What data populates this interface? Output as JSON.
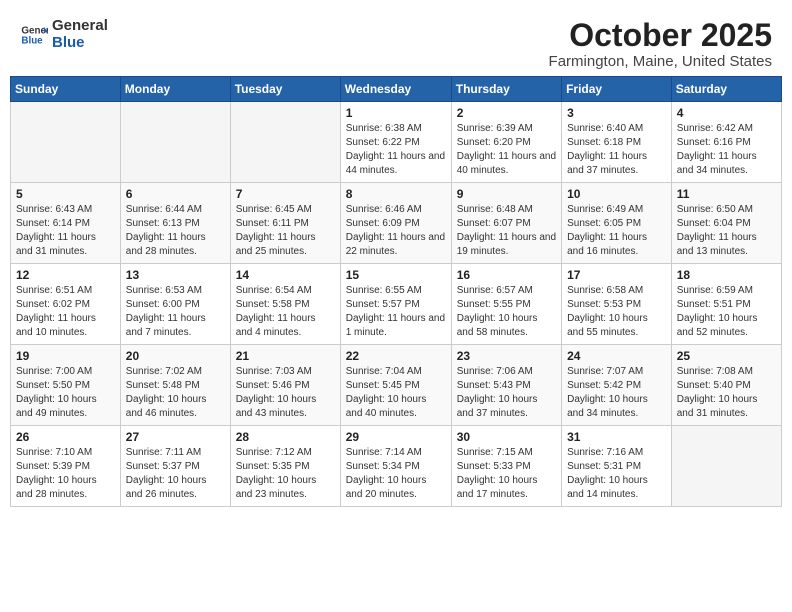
{
  "header": {
    "logo_general": "General",
    "logo_blue": "Blue",
    "month": "October 2025",
    "location": "Farmington, Maine, United States"
  },
  "weekdays": [
    "Sunday",
    "Monday",
    "Tuesday",
    "Wednesday",
    "Thursday",
    "Friday",
    "Saturday"
  ],
  "weeks": [
    [
      {
        "day": "",
        "info": ""
      },
      {
        "day": "",
        "info": ""
      },
      {
        "day": "",
        "info": ""
      },
      {
        "day": "1",
        "info": "Sunrise: 6:38 AM\nSunset: 6:22 PM\nDaylight: 11 hours\nand 44 minutes."
      },
      {
        "day": "2",
        "info": "Sunrise: 6:39 AM\nSunset: 6:20 PM\nDaylight: 11 hours\nand 40 minutes."
      },
      {
        "day": "3",
        "info": "Sunrise: 6:40 AM\nSunset: 6:18 PM\nDaylight: 11 hours\nand 37 minutes."
      },
      {
        "day": "4",
        "info": "Sunrise: 6:42 AM\nSunset: 6:16 PM\nDaylight: 11 hours\nand 34 minutes."
      }
    ],
    [
      {
        "day": "5",
        "info": "Sunrise: 6:43 AM\nSunset: 6:14 PM\nDaylight: 11 hours\nand 31 minutes."
      },
      {
        "day": "6",
        "info": "Sunrise: 6:44 AM\nSunset: 6:13 PM\nDaylight: 11 hours\nand 28 minutes."
      },
      {
        "day": "7",
        "info": "Sunrise: 6:45 AM\nSunset: 6:11 PM\nDaylight: 11 hours\nand 25 minutes."
      },
      {
        "day": "8",
        "info": "Sunrise: 6:46 AM\nSunset: 6:09 PM\nDaylight: 11 hours\nand 22 minutes."
      },
      {
        "day": "9",
        "info": "Sunrise: 6:48 AM\nSunset: 6:07 PM\nDaylight: 11 hours\nand 19 minutes."
      },
      {
        "day": "10",
        "info": "Sunrise: 6:49 AM\nSunset: 6:05 PM\nDaylight: 11 hours\nand 16 minutes."
      },
      {
        "day": "11",
        "info": "Sunrise: 6:50 AM\nSunset: 6:04 PM\nDaylight: 11 hours\nand 13 minutes."
      }
    ],
    [
      {
        "day": "12",
        "info": "Sunrise: 6:51 AM\nSunset: 6:02 PM\nDaylight: 11 hours\nand 10 minutes."
      },
      {
        "day": "13",
        "info": "Sunrise: 6:53 AM\nSunset: 6:00 PM\nDaylight: 11 hours\nand 7 minutes."
      },
      {
        "day": "14",
        "info": "Sunrise: 6:54 AM\nSunset: 5:58 PM\nDaylight: 11 hours\nand 4 minutes."
      },
      {
        "day": "15",
        "info": "Sunrise: 6:55 AM\nSunset: 5:57 PM\nDaylight: 11 hours\nand 1 minute."
      },
      {
        "day": "16",
        "info": "Sunrise: 6:57 AM\nSunset: 5:55 PM\nDaylight: 10 hours\nand 58 minutes."
      },
      {
        "day": "17",
        "info": "Sunrise: 6:58 AM\nSunset: 5:53 PM\nDaylight: 10 hours\nand 55 minutes."
      },
      {
        "day": "18",
        "info": "Sunrise: 6:59 AM\nSunset: 5:51 PM\nDaylight: 10 hours\nand 52 minutes."
      }
    ],
    [
      {
        "day": "19",
        "info": "Sunrise: 7:00 AM\nSunset: 5:50 PM\nDaylight: 10 hours\nand 49 minutes."
      },
      {
        "day": "20",
        "info": "Sunrise: 7:02 AM\nSunset: 5:48 PM\nDaylight: 10 hours\nand 46 minutes."
      },
      {
        "day": "21",
        "info": "Sunrise: 7:03 AM\nSunset: 5:46 PM\nDaylight: 10 hours\nand 43 minutes."
      },
      {
        "day": "22",
        "info": "Sunrise: 7:04 AM\nSunset: 5:45 PM\nDaylight: 10 hours\nand 40 minutes."
      },
      {
        "day": "23",
        "info": "Sunrise: 7:06 AM\nSunset: 5:43 PM\nDaylight: 10 hours\nand 37 minutes."
      },
      {
        "day": "24",
        "info": "Sunrise: 7:07 AM\nSunset: 5:42 PM\nDaylight: 10 hours\nand 34 minutes."
      },
      {
        "day": "25",
        "info": "Sunrise: 7:08 AM\nSunset: 5:40 PM\nDaylight: 10 hours\nand 31 minutes."
      }
    ],
    [
      {
        "day": "26",
        "info": "Sunrise: 7:10 AM\nSunset: 5:39 PM\nDaylight: 10 hours\nand 28 minutes."
      },
      {
        "day": "27",
        "info": "Sunrise: 7:11 AM\nSunset: 5:37 PM\nDaylight: 10 hours\nand 26 minutes."
      },
      {
        "day": "28",
        "info": "Sunrise: 7:12 AM\nSunset: 5:35 PM\nDaylight: 10 hours\nand 23 minutes."
      },
      {
        "day": "29",
        "info": "Sunrise: 7:14 AM\nSunset: 5:34 PM\nDaylight: 10 hours\nand 20 minutes."
      },
      {
        "day": "30",
        "info": "Sunrise: 7:15 AM\nSunset: 5:33 PM\nDaylight: 10 hours\nand 17 minutes."
      },
      {
        "day": "31",
        "info": "Sunrise: 7:16 AM\nSunset: 5:31 PM\nDaylight: 10 hours\nand 14 minutes."
      },
      {
        "day": "",
        "info": ""
      }
    ]
  ]
}
